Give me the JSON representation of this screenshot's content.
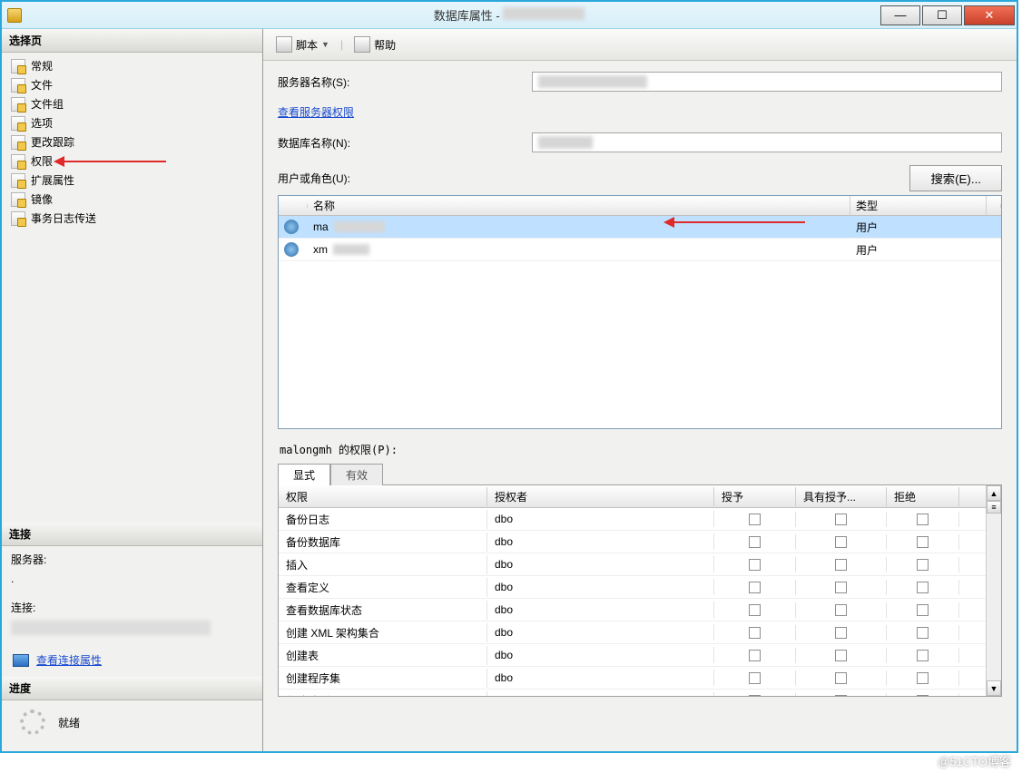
{
  "window": {
    "title": "数据库属性 -",
    "min": "—",
    "max": "☐",
    "close": "✕"
  },
  "leftpanel": {
    "select_page": "选择页",
    "items": [
      {
        "label": "常规"
      },
      {
        "label": "文件"
      },
      {
        "label": "文件组"
      },
      {
        "label": "选项"
      },
      {
        "label": "更改跟踪"
      },
      {
        "label": "权限"
      },
      {
        "label": "扩展属性"
      },
      {
        "label": "镜像"
      },
      {
        "label": "事务日志传送"
      }
    ],
    "connection_header": "连接",
    "server_label": "服务器:",
    "server_value": ".",
    "conn_label": "连接:",
    "view_conn_link": "查看连接属性",
    "progress_header": "进度",
    "ready": "就绪"
  },
  "toolbar": {
    "script": "脚本",
    "help": "帮助"
  },
  "form": {
    "server_name_label": "服务器名称(S):",
    "view_server_perm": "查看服务器权限",
    "db_name_label": "数据库名称(N):",
    "users_label": "用户或角色(U):",
    "search_btn": "搜索(E)..."
  },
  "users_grid": {
    "col_name": "名称",
    "col_type": "类型",
    "rows": [
      {
        "name": "ma",
        "type": "用户"
      },
      {
        "name": "xm",
        "type": "用户"
      }
    ]
  },
  "perm": {
    "label": "malongmh 的权限(P):",
    "tab_explicit": "显式",
    "tab_effective": "有效",
    "col_perm": "权限",
    "col_grantor": "授权者",
    "col_grant": "授予",
    "col_with": "具有授予...",
    "col_deny": "拒绝",
    "rows": [
      {
        "p": "备份日志",
        "g": "dbo"
      },
      {
        "p": "备份数据库",
        "g": "dbo"
      },
      {
        "p": "插入",
        "g": "dbo"
      },
      {
        "p": "查看定义",
        "g": "dbo"
      },
      {
        "p": "查看数据库状态",
        "g": "dbo"
      },
      {
        "p": "创建 XML 架构集合",
        "g": "dbo"
      },
      {
        "p": "创建表",
        "g": "dbo"
      },
      {
        "p": "创建程序集",
        "g": "dbo"
      },
      {
        "p": "创建队列",
        "g": "dbo"
      }
    ]
  },
  "watermark": "@51CTO博客"
}
